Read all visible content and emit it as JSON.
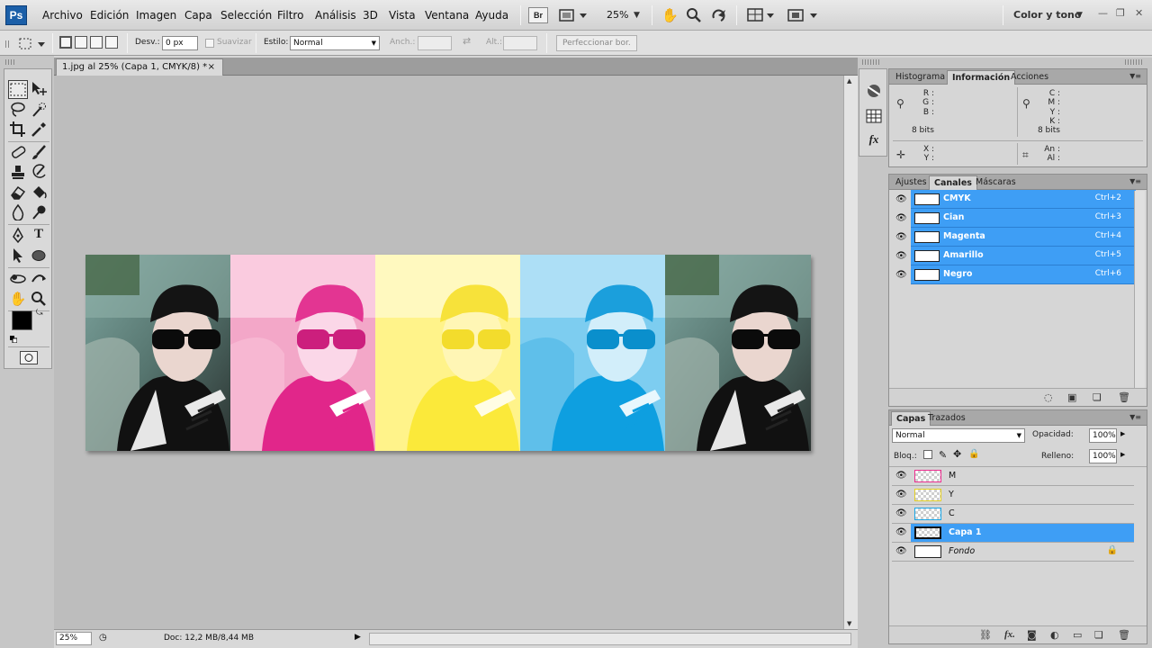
{
  "app": {
    "logo": "Ps",
    "menu": [
      "Archivo",
      "Edición",
      "Imagen",
      "Capa",
      "Selección",
      "Filtro",
      "Análisis",
      "3D",
      "Vista",
      "Ventana",
      "Ayuda"
    ],
    "bridge_label": "Br",
    "zoom": "25%",
    "workspace": "Color y tono",
    "icons": [
      "bridge-icon",
      "view-extras-icon",
      "hand-icon",
      "zoom-icon",
      "rotate-view-icon",
      "arrange-docs-icon",
      "screen-mode-icon"
    ]
  },
  "options": {
    "feather_label": "Desv.:",
    "feather_value": "0 px",
    "antialias_label": "Suavizar",
    "style_label": "Estilo:",
    "style_value": "Normal",
    "width_label": "Anch.:",
    "height_label": "Alt.:",
    "refine_label": "Perfeccionar bor."
  },
  "document": {
    "tab_title": "1.jpg al 25% (Capa 1, CMYK/8) *",
    "close": "×",
    "status_zoom": "25%",
    "status_doc": "Doc: 12,2 MB/8,44 MB"
  },
  "info_panel": {
    "tabs": [
      "Histograma",
      "Información",
      "Acciones"
    ],
    "rgb": [
      "R :",
      "G :",
      "B :"
    ],
    "rgb_bits": "8 bits",
    "cmyk": [
      "C :",
      "M :",
      "Y :",
      "K :"
    ],
    "cmyk_bits": "8 bits",
    "xy": [
      "X :",
      "Y :"
    ],
    "wh": [
      "An :",
      "Al :"
    ]
  },
  "channels_panel": {
    "tabs": [
      "Ajustes",
      "Canales",
      "Máscaras"
    ],
    "channels": [
      {
        "name": "CMYK",
        "shortcut": "Ctrl+2"
      },
      {
        "name": "Cian",
        "shortcut": "Ctrl+3"
      },
      {
        "name": "Magenta",
        "shortcut": "Ctrl+4"
      },
      {
        "name": "Amarillo",
        "shortcut": "Ctrl+5"
      },
      {
        "name": "Negro",
        "shortcut": "Ctrl+6"
      }
    ]
  },
  "layers_panel": {
    "tabs": [
      "Capas",
      "Trazados"
    ],
    "blend_mode": "Normal",
    "opacity_label": "Opacidad:",
    "opacity_value": "100%",
    "lock_label": "Bloq.:",
    "fill_label": "Relleno:",
    "fill_value": "100%",
    "layers": [
      {
        "name": "M",
        "tint": "#ec2d8e"
      },
      {
        "name": "Y",
        "tint": "#f7e53d"
      },
      {
        "name": "C",
        "tint": "#1aa6e6"
      },
      {
        "name": "Capa 1",
        "selected": true
      },
      {
        "name": "Fondo",
        "italic": true,
        "locked": true
      }
    ]
  },
  "colors": {
    "selection_blue": "#3e9ef5",
    "cyan": "#1aaeef",
    "magenta": "#ec2d8e",
    "yellow": "#fff02b"
  }
}
